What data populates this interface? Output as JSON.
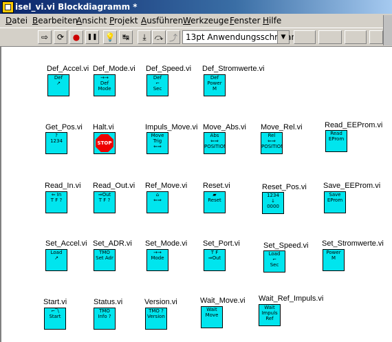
{
  "window": {
    "title": "isel_vi.vi Blockdiagramm *"
  },
  "menu": [
    "Datei",
    "Bearbeiten",
    "Ansicht",
    "Projekt",
    "Ausführen",
    "Werkzeuge",
    "Fenster",
    "Hilfe"
  ],
  "toolbar": {
    "font": "13pt Anwendungsschriftart",
    "run_arrow": "⇨",
    "run_continuous": "⟳",
    "abort": "●",
    "pause": "❚❚",
    "highlight": "💡",
    "retain": "↹",
    "step_into": "⤓",
    "step_over": "⤼",
    "step_out": "⤴"
  },
  "vis": [
    {
      "label": "Def_Accel.vi",
      "lines": [
        "Def",
        "↗"
      ]
    },
    {
      "label": "Def_Mode.vi",
      "lines": [
        "→→",
        "Def",
        "Mode"
      ]
    },
    {
      "label": "Def_Speed.vi",
      "lines": [
        "Def",
        "⌐",
        "Sec"
      ]
    },
    {
      "label": "Def_Stromwerte.vi",
      "lines": [
        "Def",
        "Power",
        "M"
      ]
    },
    {
      "label": "Get_Pos.vi",
      "lines": [
        "?",
        "1234"
      ]
    },
    {
      "label": "Halt.vi",
      "lines": [
        "STOP"
      ]
    },
    {
      "label": "Impuls_Move.vi",
      "lines": [
        "Move",
        "Trig",
        "⇐⇒"
      ]
    },
    {
      "label": "Move_Abs.vi",
      "lines": [
        "Abs",
        "⇐⇒",
        "POSITION"
      ]
    },
    {
      "label": "Move_Rel.vi",
      "lines": [
        "Rel",
        "⇐⇒",
        "POSITION"
      ]
    },
    {
      "label": "Read_EEProm.vi",
      "lines": [
        "Read",
        "EProm"
      ]
    },
    {
      "label": "Read_In.vi",
      "lines": [
        "⇐ In",
        "T F ?"
      ]
    },
    {
      "label": "Read_Out.vi",
      "lines": [
        "⇒Out",
        "T F ?"
      ]
    },
    {
      "label": "Ref_Move.vi",
      "lines": [
        "⌂",
        "⇐⇒"
      ]
    },
    {
      "label": "Reset.vi",
      "lines": [
        "▰",
        "Reset"
      ]
    },
    {
      "label": "Reset_Pos.vi",
      "lines": [
        "1234",
        "↓",
        "0000"
      ]
    },
    {
      "label": "Save_EEProm.vi",
      "lines": [
        "Save",
        "EProm"
      ]
    },
    {
      "label": "Set_Accel.vi",
      "lines": [
        "Load",
        "↗"
      ]
    },
    {
      "label": "Set_ADR.vi",
      "lines": [
        "TMO",
        "Set Adr"
      ]
    },
    {
      "label": "Set_Mode.vi",
      "lines": [
        "→→",
        "Mode"
      ]
    },
    {
      "label": "Set_Port.vi",
      "lines": [
        "T F",
        "⇒Out"
      ]
    },
    {
      "label": "Set_Speed.vi",
      "lines": [
        "Load",
        "⌐",
        "Sec"
      ]
    },
    {
      "label": "Set_Stromwerte.vi",
      "lines": [
        "Power",
        "M"
      ]
    },
    {
      "label": "Start.vi",
      "lines": [
        "⌐‾\\",
        "Start"
      ]
    },
    {
      "label": "Status.vi",
      "lines": [
        "TMO",
        "Info ?"
      ]
    },
    {
      "label": "Version.vi",
      "lines": [
        "TMO ?",
        "Version"
      ]
    },
    {
      "label": "Wait_Move.vi",
      "lines": [
        "Wait",
        "Move"
      ]
    },
    {
      "label": "Wait_Ref_Impuls.vi",
      "lines": [
        "Wait",
        "Impuls",
        "Ref"
      ]
    }
  ]
}
